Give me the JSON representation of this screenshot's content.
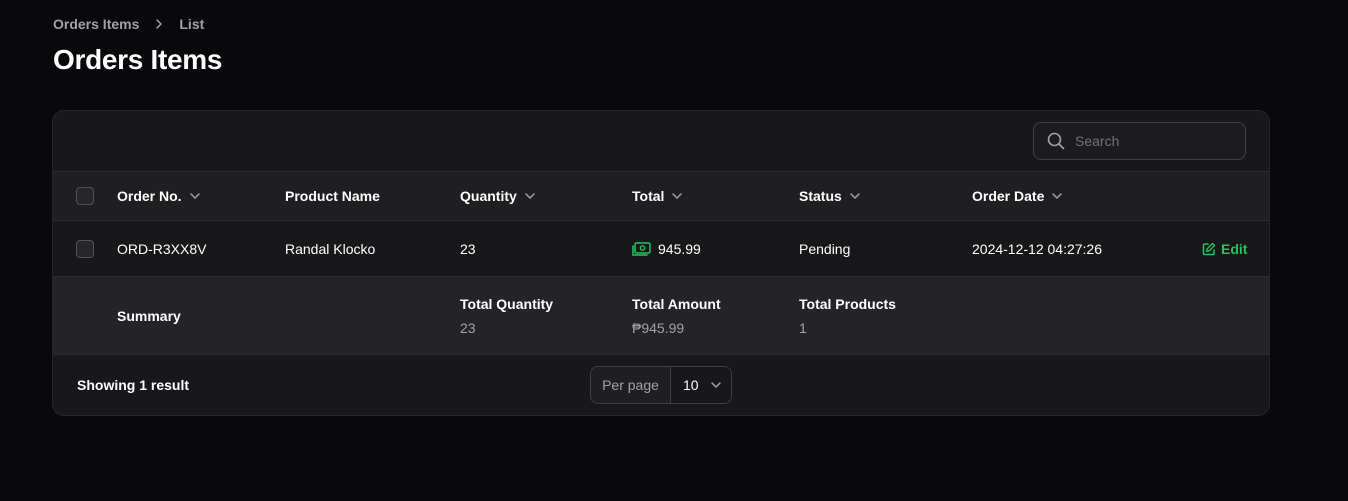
{
  "breadcrumb": {
    "parent": "Orders Items",
    "current": "List"
  },
  "page": {
    "title": "Orders Items"
  },
  "search": {
    "placeholder": "Search"
  },
  "table": {
    "columns": {
      "order_no": "Order No.",
      "product_name": "Product Name",
      "quantity": "Quantity",
      "total": "Total",
      "status": "Status",
      "order_date": "Order Date"
    },
    "rows": [
      {
        "order_no": "ORD-R3XX8V",
        "product_name": "Randal Klocko",
        "quantity": "23",
        "total": "945.99",
        "status": "Pending",
        "order_date": "2024-12-12 04:27:26",
        "action": "Edit"
      }
    ]
  },
  "summary": {
    "label": "Summary",
    "total_quantity": {
      "title": "Total Quantity",
      "value": "23"
    },
    "total_amount": {
      "title": "Total Amount",
      "value": "₱945.99"
    },
    "total_products": {
      "title": "Total Products",
      "value": "1"
    }
  },
  "footer": {
    "showing": "Showing 1 result",
    "per_page_label": "Per page",
    "per_page_value": "10"
  },
  "colors": {
    "accent": "#22c55e",
    "background": "#09090b",
    "card": "#18181b"
  },
  "icons": [
    "chevron-right-icon",
    "search-icon",
    "chevron-down-icon",
    "money-icon",
    "edit-icon"
  ]
}
